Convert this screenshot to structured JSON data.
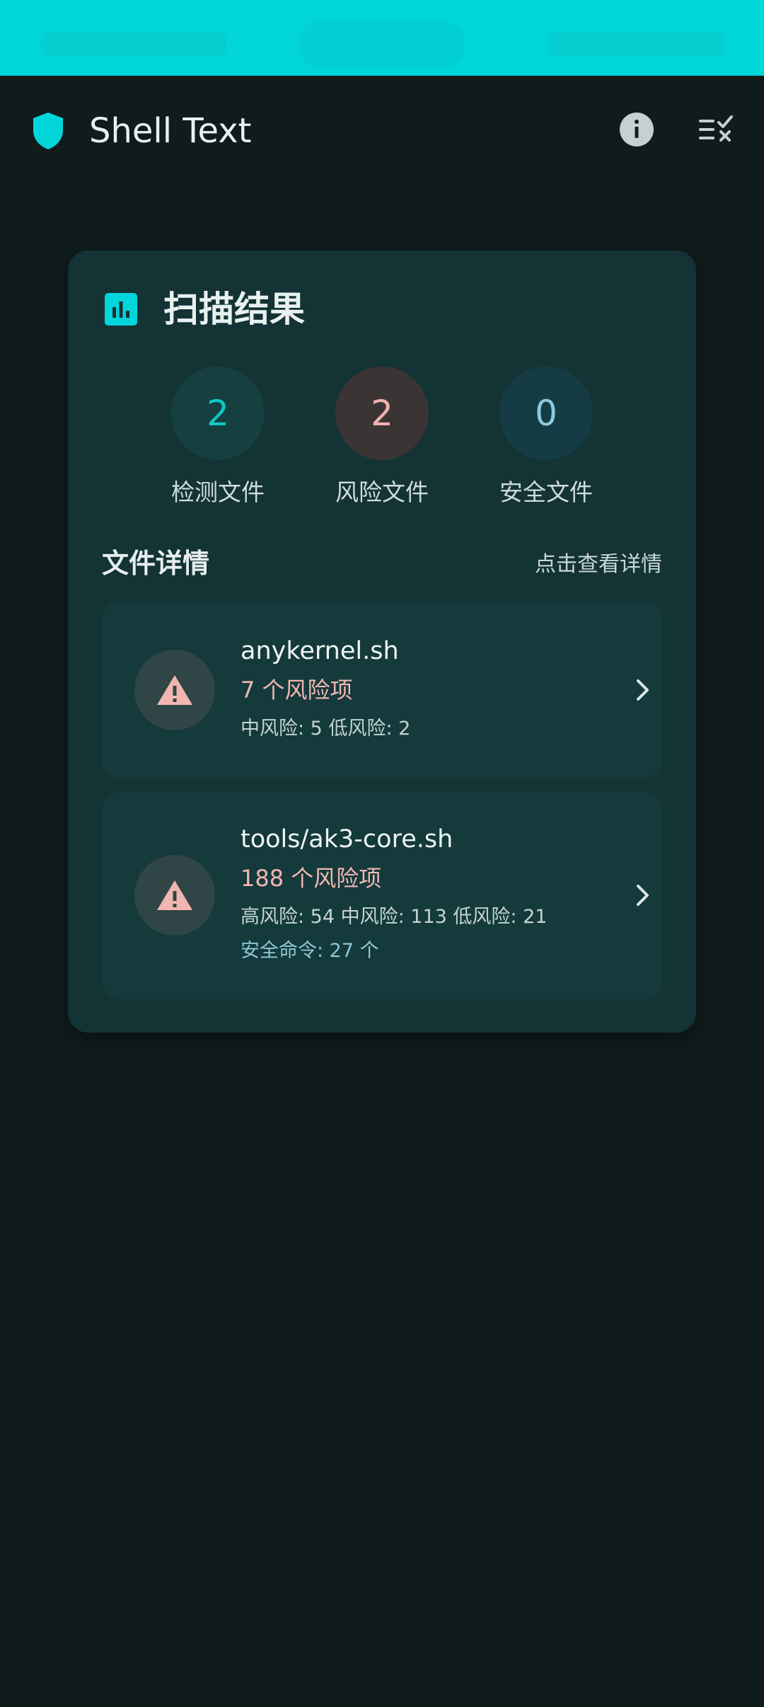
{
  "app": {
    "title": "Shell Text"
  },
  "colors": {
    "accent": "#00d6d9",
    "background": "#101b1c",
    "card": "#133335",
    "risk": "#f2b6b2",
    "safe": "#8ec8d6"
  },
  "scan": {
    "title": "扫描结果",
    "stats": [
      {
        "value": "2",
        "label": "检测文件",
        "color": "#12c7c9",
        "bg": "#163f40"
      },
      {
        "value": "2",
        "label": "风险文件",
        "color": "#f0b2ad",
        "bg": "#3b3434"
      },
      {
        "value": "0",
        "label": "安全文件",
        "color": "#8ec8e0",
        "bg": "#153c45"
      }
    ]
  },
  "files": {
    "section_title": "文件详情",
    "view_details": "点击查看详情",
    "items": [
      {
        "name": "anykernel.sh",
        "risk_count": "7 个风险项",
        "detail": "中风险: 5 低风险: 2",
        "safe": ""
      },
      {
        "name": "tools/ak3-core.sh",
        "risk_count": "188 个风险项",
        "detail": "高风险: 54 中风险: 113 低风险: 21",
        "safe": "安全命令: 27 个"
      }
    ]
  },
  "icons": {
    "logo": "shield-icon",
    "info": "info-icon",
    "menu": "list-check-icon",
    "chart": "bar-chart-icon",
    "warning": "warning-icon",
    "chevron": "chevron-right-icon"
  }
}
